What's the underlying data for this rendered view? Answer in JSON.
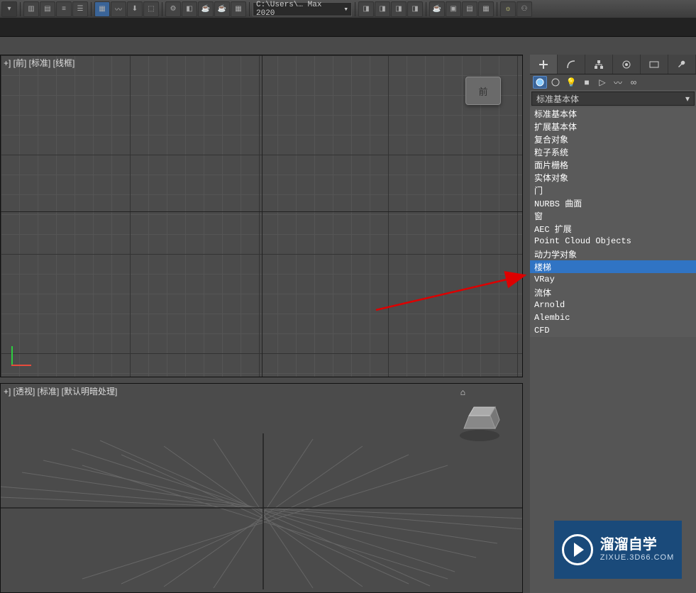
{
  "toolbar": {
    "path": "C:\\Users\\… Max 2020"
  },
  "viewports": {
    "top": {
      "label": "+] [前] [标准] [线框]",
      "cube_label": "前"
    },
    "bottom": {
      "label": "+] [透视] [标准] [默认明暗处理]"
    }
  },
  "command_panel": {
    "dropdown_selected": "标准基本体",
    "categories": [
      "标准基本体",
      "扩展基本体",
      "复合对象",
      "粒子系统",
      "面片栅格",
      "实体对象",
      "门",
      "NURBS 曲面",
      "窗",
      "AEC 扩展",
      "Point Cloud Objects",
      "动力学对象",
      "楼梯",
      "VRay",
      "流体",
      "Arnold",
      "Alembic",
      "CFD"
    ],
    "highlighted_index": 12
  },
  "watermark": {
    "title": "溜溜自学",
    "subtitle": "ZIXUE.3D66.COM"
  }
}
